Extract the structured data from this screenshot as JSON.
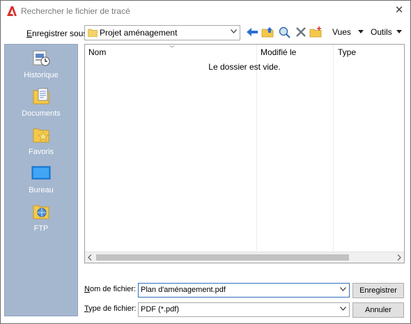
{
  "window": {
    "title": "Rechercher le fichier de tracé",
    "close_symbol": "✕"
  },
  "toolbar": {
    "save_in_label": "Enregistrer sous:",
    "current_folder": "Projet aménagement",
    "views_label": "Vues",
    "tools_label": "Outils"
  },
  "places": [
    {
      "label": "Historique",
      "icon": "history-icon"
    },
    {
      "label": "Documents",
      "icon": "documents-icon"
    },
    {
      "label": "Favoris",
      "icon": "favorites-icon"
    },
    {
      "label": "Bureau",
      "icon": "desktop-icon"
    },
    {
      "label": "FTP",
      "icon": "ftp-icon"
    }
  ],
  "file_list": {
    "columns": [
      "Nom",
      "Modifié le",
      "Type"
    ],
    "empty_message": "Le dossier est vide."
  },
  "footer": {
    "filename_label": "Nom de fichier:",
    "filename_value": "Plan d'aménagement.pdf",
    "filetype_label": "Type de fichier:",
    "filetype_value": "PDF (*.pdf)",
    "save_button": "Enregistrer",
    "cancel_button": "Annuler"
  },
  "colors": {
    "sidebar_bg": "#a5b7cf",
    "accent": "#d9312b"
  }
}
